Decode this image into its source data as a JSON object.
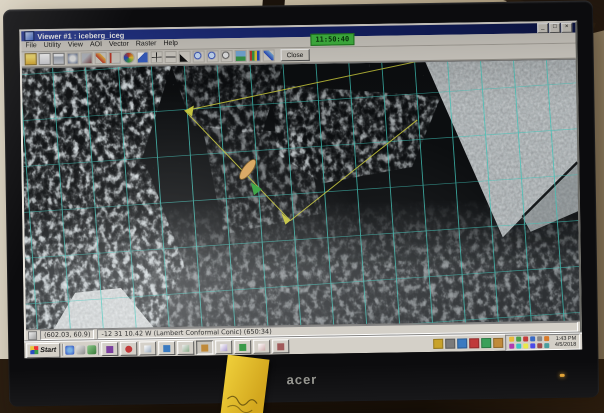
{
  "monitor": {
    "brand_label": "acer"
  },
  "overlay_clock": {
    "time": "11:50:40",
    "bg_color": "#3aa53a"
  },
  "viewer_window": {
    "title": "Viewer #1 : iceberg_iceg",
    "menus": [
      "File",
      "Utility",
      "View",
      "AOI",
      "Vector",
      "Raster",
      "Help"
    ],
    "toolbar": {
      "close_label": "Close",
      "icon_names": [
        "open-folder",
        "new-sheet",
        "printer",
        "redisplay",
        "stamp",
        "pencil",
        "measure",
        "palette",
        "select-pointer",
        "crosshair",
        "dash-line",
        "arrow-tool",
        "zoom-in",
        "zoom-box",
        "zoom-out",
        "image-display",
        "band-chart",
        "blue-pen"
      ]
    },
    "status": {
      "cursor": "(602.03, 60.9)",
      "readout": "-12 31 10.42 W  (Lambert Conformal Conic)  (650:34)"
    }
  },
  "canvas_overlays": {
    "grid_color": "#3fc4b8",
    "track_color": "#c2c23a",
    "ship_color": "#d8a45c",
    "marker_color": "#2fa03a"
  },
  "taskbar": {
    "start_label": "Start",
    "clock_time": "1:43 PM",
    "clock_date": "4/5/2018"
  }
}
